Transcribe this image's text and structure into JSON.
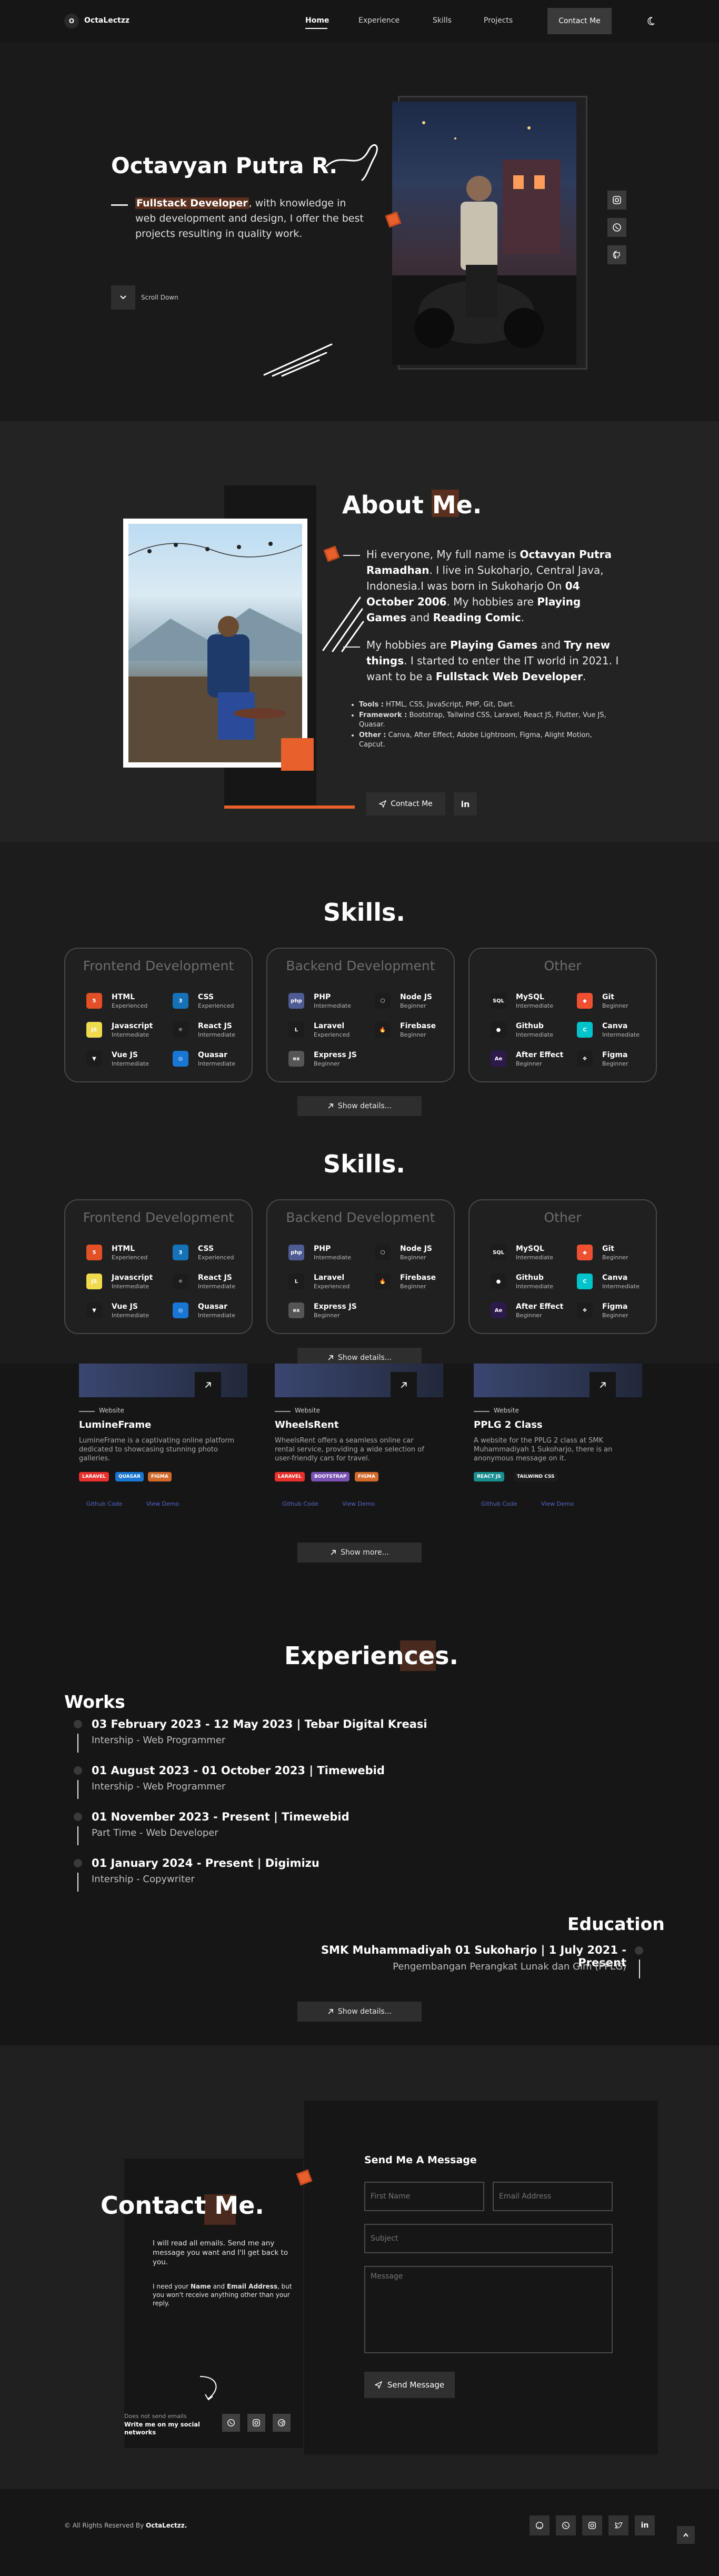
{
  "colors": {
    "accent": "#e8602c",
    "bg": "#161616"
  },
  "nav": {
    "logo_badge": "O",
    "logo_text": "OctaLectzz",
    "links": [
      "Home",
      "Experience",
      "Skills",
      "Projects"
    ],
    "cta": "Contact Me",
    "theme_icon": "moon-icon"
  },
  "hero": {
    "name": "Octavyan Putra R.",
    "desc_highlight": "Fullstack Developer",
    "desc_rest": ", with knowledge in web development and design, I offer the best projects resulting in quality work.",
    "scroll_text": "Scroll Down",
    "socials": [
      "instagram-icon",
      "whatsapp-icon",
      "github-icon"
    ]
  },
  "about": {
    "title": "About Me.",
    "p1_a": "Hi everyone, My full name is ",
    "p1_name": "Octavyan Putra Ramadhan",
    "p1_b": ". I live in Sukoharjo, Central Java, Indonesia.I was born in Sukoharjo On ",
    "p1_date": "04 October 2006",
    "p1_c": ". My hobbies are ",
    "p1_h1": "Playing Games",
    "p1_d": " and ",
    "p1_h2": "Reading Comic",
    "p1_e": ".",
    "p2_a": "My hobbies are ",
    "p2_h1": "Playing Games",
    "p2_b": " and ",
    "p2_h2": "Try new things",
    "p2_c": ". I started to enter the IT world in 2021. I want to be a ",
    "p2_h3": "Fullstack Web Developer",
    "p2_d": ".",
    "list": [
      {
        "label": "Tools :",
        "text": " HTML, CSS, JavaScript, PHP, Git, Dart."
      },
      {
        "label": "Framework :",
        "text": " Bootstrap, Tailwind CSS, Laravel, React JS, Flutter, Vue JS, Quasar."
      },
      {
        "label": "Other :",
        "text": " Canva, After Effect, Adobe Lightroom, Figma, Alight Motion, Capcut."
      }
    ],
    "contact_btn": "Contact Me",
    "linkedin": "in"
  },
  "skills": {
    "title": "Skills.",
    "cards": [
      {
        "title": "Frontend Development",
        "items": [
          {
            "name": "HTML",
            "level": "Experienced",
            "icon": "html-icon",
            "color": "#e34f26",
            "glyph": "5"
          },
          {
            "name": "CSS",
            "level": "Experienced",
            "icon": "css-icon",
            "color": "#1572b6",
            "glyph": "3"
          },
          {
            "name": "Javascript",
            "level": "Intermediate",
            "icon": "javascript-icon",
            "color": "#f0db4f",
            "glyph": "JS"
          },
          {
            "name": "React JS",
            "level": "Intermediate",
            "icon": "react-icon",
            "color": "#1c1c1c",
            "glyph": "⚛"
          },
          {
            "name": "Vue JS",
            "level": "Intermediate",
            "icon": "vue-icon",
            "color": "#1c1c1c",
            "glyph": "▼"
          },
          {
            "name": "Quasar",
            "level": "Intermediate",
            "icon": "quasar-icon",
            "color": "#1976d2",
            "glyph": "◎"
          }
        ]
      },
      {
        "title": "Backend Development",
        "items": [
          {
            "name": "PHP",
            "level": "Intermediate",
            "icon": "php-icon",
            "color": "#4f5b93",
            "glyph": "php"
          },
          {
            "name": "Node JS",
            "level": "Beginner",
            "icon": "node-icon",
            "color": "#1c1c1c",
            "glyph": "⬡"
          },
          {
            "name": "Laravel",
            "level": "Experienced",
            "icon": "laravel-icon",
            "color": "#1c1c1c",
            "glyph": "L"
          },
          {
            "name": "Firebase",
            "level": "Beginner",
            "icon": "firebase-icon",
            "color": "#1c1c1c",
            "glyph": "🔥"
          },
          {
            "name": "Express JS",
            "level": "Beginner",
            "icon": "express-icon",
            "color": "#555555",
            "glyph": "ex"
          }
        ]
      },
      {
        "title": "Other",
        "items": [
          {
            "name": "MySQL",
            "level": "Intermediate",
            "icon": "mysql-icon",
            "color": "#1c1c1c",
            "glyph": "SQL"
          },
          {
            "name": "Git",
            "level": "Beginner",
            "icon": "git-icon",
            "color": "#f05032",
            "glyph": "◆"
          },
          {
            "name": "Github",
            "level": "Intermediate",
            "icon": "github-icon",
            "color": "#1c1c1c",
            "glyph": "●"
          },
          {
            "name": "Canva",
            "level": "Intermediate",
            "icon": "canva-icon",
            "color": "#00c4cc",
            "glyph": "C"
          },
          {
            "name": "After Effect",
            "level": "Beginner",
            "icon": "after-effects-icon",
            "color": "#2b1a4a",
            "glyph": "Ae"
          },
          {
            "name": "Figma",
            "level": "Beginner",
            "icon": "figma-icon",
            "color": "#1c1c1c",
            "glyph": "❖"
          }
        ]
      }
    ],
    "show_details": "Show details..."
  },
  "projects": {
    "items": [
      {
        "type": "Website",
        "title": "LumineFrame",
        "desc": "LumineFrame is a captivating online platform dedicated to showcasing stunning photo galleries.",
        "tags": [
          {
            "t": "LARAVEL",
            "c": "#e8302c"
          },
          {
            "t": "QUASAR",
            "c": "#1976d2"
          },
          {
            "t": "FIGMA",
            "c": "#d26a2c"
          }
        ]
      },
      {
        "type": "Website",
        "title": "WheelsRent",
        "desc": "WheelsRent offers a seamless online car rental service, providing a wide selection of user-friendly cars for travel.",
        "tags": [
          {
            "t": "LARAVEL",
            "c": "#e8302c"
          },
          {
            "t": "BOOTSTRAP",
            "c": "#7952b3"
          },
          {
            "t": "FIGMA",
            "c": "#d26a2c"
          }
        ]
      },
      {
        "type": "Website",
        "title": "PPLG 2 Class",
        "desc": "A website for the PPLG 2 class at SMK Muhammadiyah 1 Sukoharjo, there is an anonymous message on it.",
        "tags": [
          {
            "t": "REACT JS",
            "c": "#1a8f8f"
          },
          {
            "t": "TAILWIND CSS",
            "c": "#1c1c1c"
          }
        ]
      }
    ],
    "link_github": "Github Code",
    "link_view": "View Demo",
    "show_more": "Show more..."
  },
  "experiences": {
    "title": "Experiences.",
    "works_title": "Works",
    "works": [
      {
        "head": "03 February 2023 - 12 May 2023 | Tebar Digital Kreasi",
        "sub": "Intership - Web Programmer"
      },
      {
        "head": "01 August 2023 - 01 October 2023 | Timewebid",
        "sub": "Intership - Web Programmer"
      },
      {
        "head": "01 November 2023 - Present | Timewebid",
        "sub": "Part Time - Web Developer"
      },
      {
        "head": "01 January 2024 - Present | Digimizu",
        "sub": "Intership - Copywriter"
      }
    ],
    "edu_title": "Education",
    "edu_head": "SMK Muhammadiyah 01 Sukoharjo | 1 July 2021 - Present",
    "edu_sub": "Pengembangan Perangkat Lunak dan Gim (PPLG)",
    "show_details": "Show details..."
  },
  "contact": {
    "title": "Contact Me.",
    "p1": "I will read all emails. Send me any message you want and I'll get back to you.",
    "p2_a": "I need your ",
    "p2_b": "Name",
    "p2_c": " and ",
    "p2_d": "Email Address",
    "p2_e": ", but you won't receive anything other than your reply.",
    "no_email": "Does not send emails",
    "social_title": "Write me on my social networks",
    "form_title": "Send Me A Message",
    "placeholder_first": "First Name",
    "placeholder_email": "Email Address",
    "placeholder_subject": "Subject",
    "placeholder_message": "Message",
    "send_btn": "Send Message"
  },
  "footer": {
    "copyright_a": "© All Rights Reserved By ",
    "copyright_b": "OctaLectzz."
  }
}
